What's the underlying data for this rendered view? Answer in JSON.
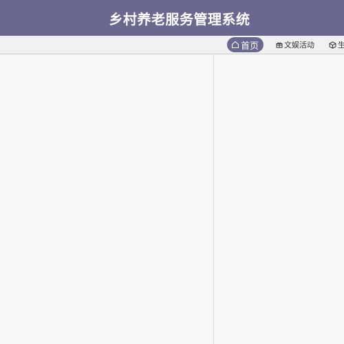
{
  "header": {
    "title": "乡村养老服务管理系统"
  },
  "nav": {
    "items": [
      {
        "label": "首页",
        "icon": "home-icon",
        "active": true
      },
      {
        "label": "文娱活动",
        "icon": "gift-icon",
        "active": false
      },
      {
        "label": "生",
        "icon": "cube-icon",
        "active": false
      }
    ]
  },
  "colors": {
    "primary": "#6b6890",
    "nav_background": "#f1f1f4",
    "content_background": "#f8f8f8"
  }
}
